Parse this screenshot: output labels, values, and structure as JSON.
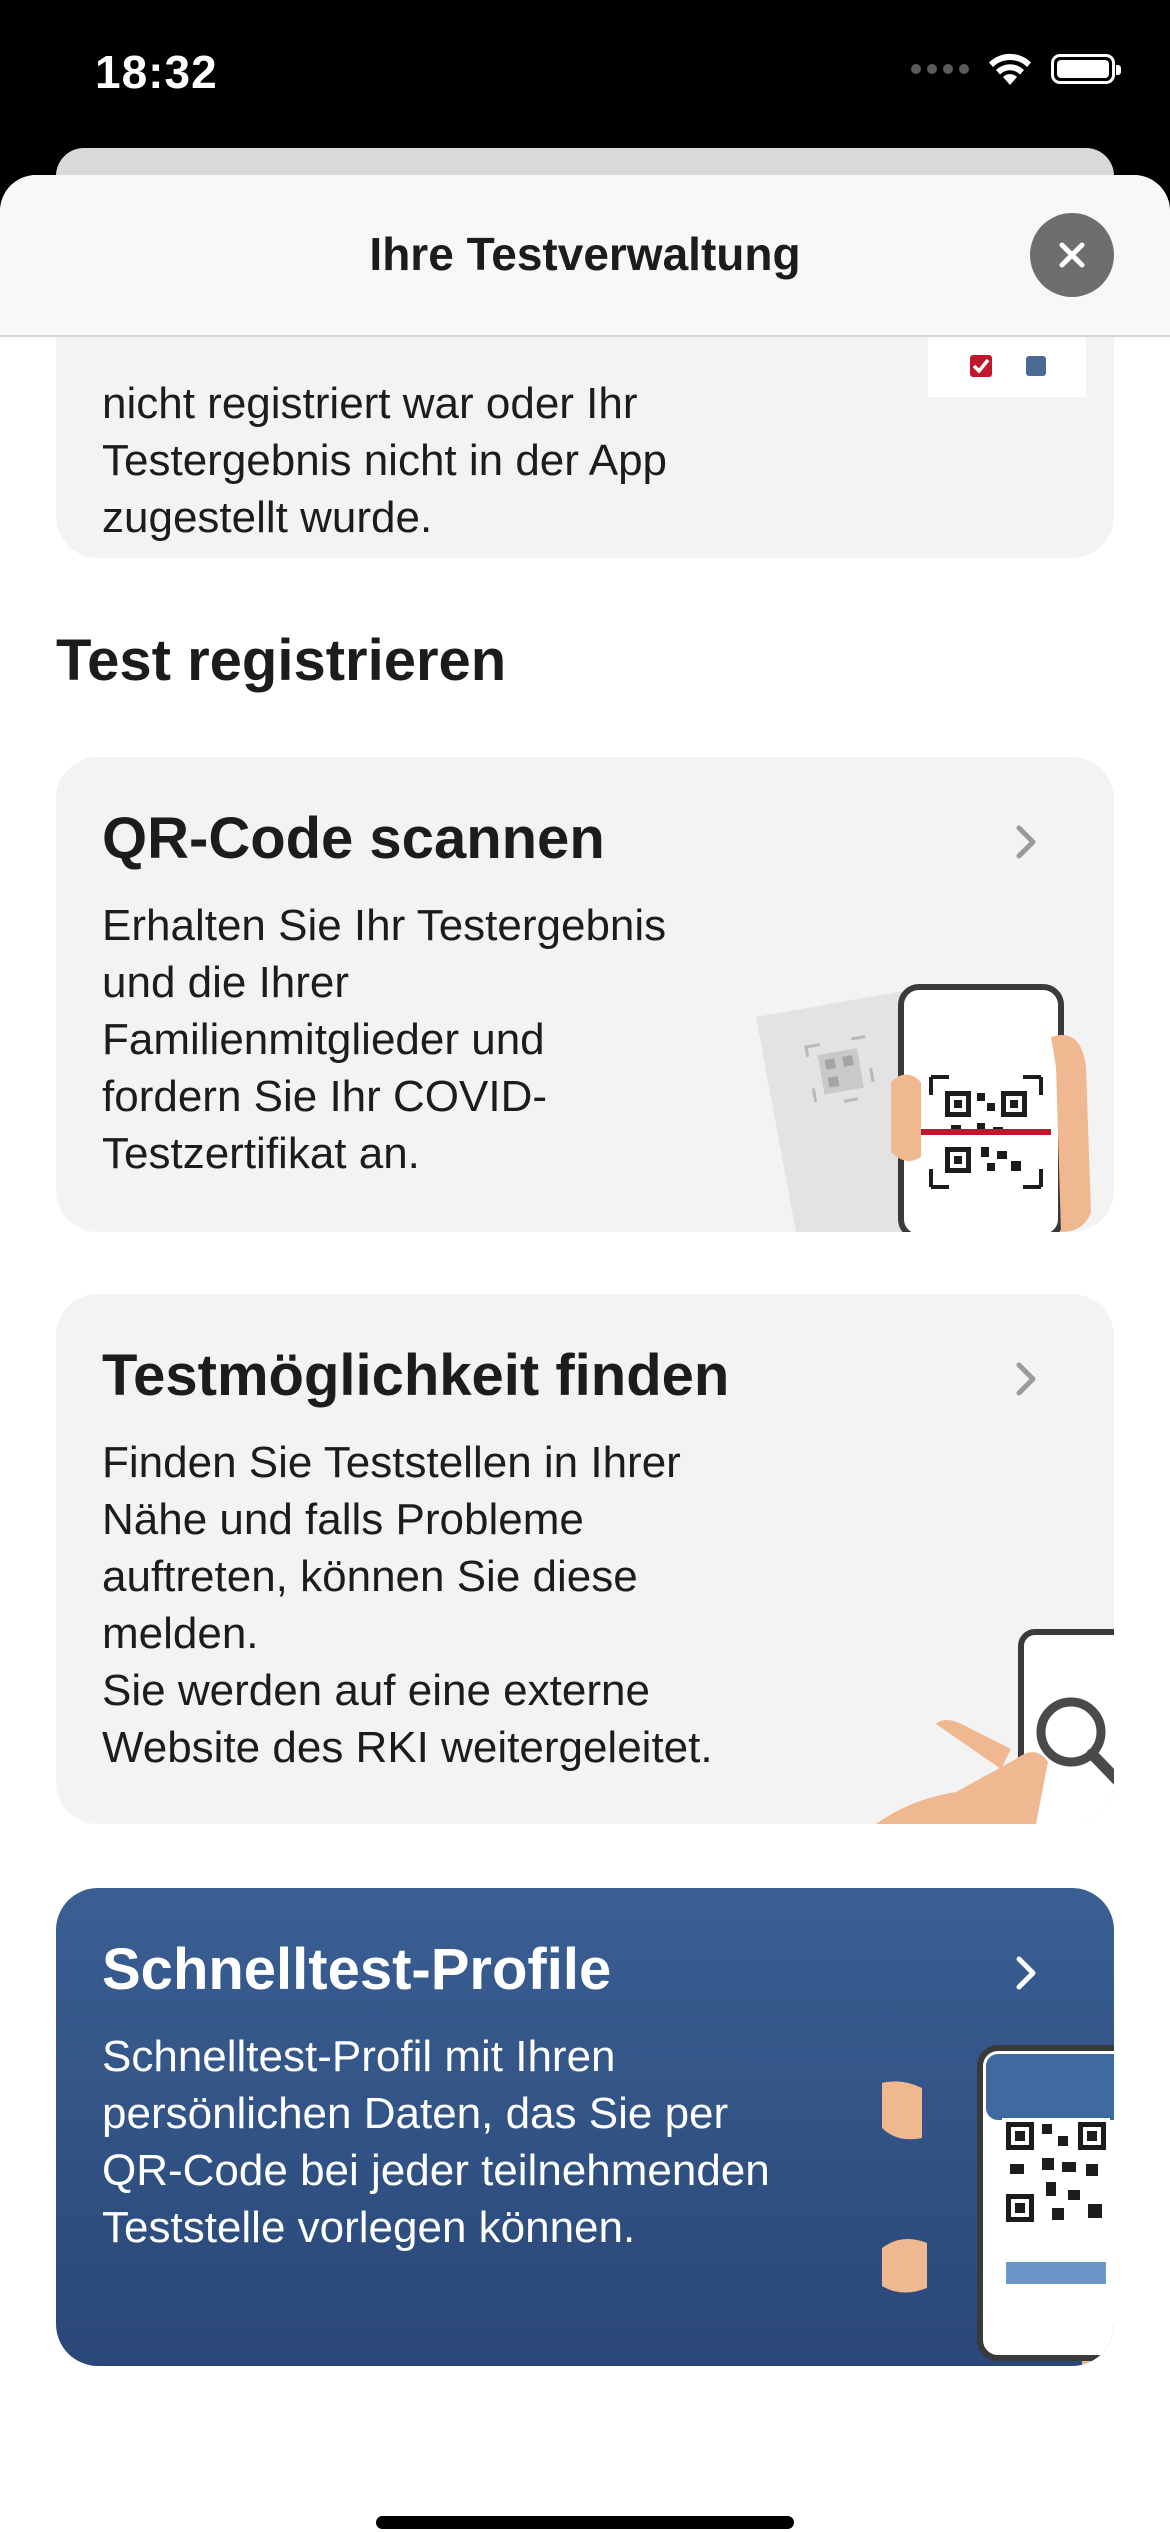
{
  "status_bar": {
    "time": "18:32"
  },
  "header": {
    "title": "Ihre Testverwaltung"
  },
  "previous_card": {
    "text": "nicht registriert war oder Ihr\nTestergebnis nicht in der App\nzugestellt wurde."
  },
  "section": {
    "heading": "Test registrieren"
  },
  "cards": [
    {
      "title": "QR-Code scannen",
      "text": "Erhalten Sie Ihr Testergebnis\nund die Ihrer\nFamilienmitglieder und\nfordern Sie Ihr COVID-\nTestzertifikat an."
    },
    {
      "title": "Testmöglichkeit finden",
      "text": "Finden Sie Teststellen in Ihrer\nNähe und falls Probleme\nauftreten, können Sie diese\nmelden.\nSie werden auf eine externe\nWebsite des RKI weitergeleitet."
    },
    {
      "title": "Schnelltest-Profile",
      "text": "Schnelltest-Profil mit Ihren\npersönlichen Daten, das Sie per\nQR-Code bei jeder teilnehmenden\nTeststelle vorlegen können."
    }
  ],
  "icons": {
    "close": "close-icon",
    "chevron": "chevron-right-icon",
    "wifi": "wifi-icon",
    "battery": "battery-icon",
    "signal": "signal-icon"
  },
  "colors": {
    "card_background": "#f3f3f3",
    "rapid_card_background": "#2f4f82",
    "checkbox_red": "#c0172c",
    "checkbox_blue": "#4a6a94",
    "scan_line_red": "#c0172c",
    "hand_skin": "#f0b890"
  }
}
